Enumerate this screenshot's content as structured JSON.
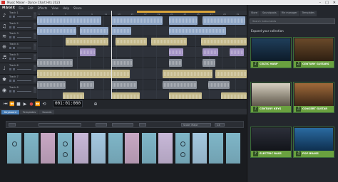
{
  "window": {
    "title": "Music Maker - Dance Chart Hits 2023",
    "minimize": "–",
    "maximize": "□",
    "close": "✕"
  },
  "menu": {
    "brand": "MAGIX",
    "items": [
      "File",
      "Edit",
      "Effects",
      "View",
      "Help",
      "Share"
    ]
  },
  "ruler": {
    "bars": [
      "1",
      "3",
      "5",
      "7",
      "9",
      "11",
      "13",
      "15",
      "17",
      "19",
      "21",
      "23",
      "25",
      "27",
      "29",
      "31"
    ]
  },
  "tracks": [
    {
      "icon": "piano-keys-icon",
      "glyph": "♪",
      "name": "Track 1"
    },
    {
      "icon": "flute-icon",
      "glyph": "♫",
      "name": "Track 2"
    },
    {
      "icon": "synth-icon",
      "glyph": "≋",
      "name": "Track 3"
    },
    {
      "icon": "drums-icon",
      "glyph": "⊕",
      "name": "Track 4"
    },
    {
      "icon": "strings-icon",
      "glyph": "♬",
      "name": "Track 5"
    },
    {
      "icon": "guitar-icon",
      "glyph": "♩",
      "name": "Track 6"
    },
    {
      "icon": "fx-icon",
      "glyph": "✱",
      "name": "Track 7"
    },
    {
      "icon": "vocal-icon",
      "glyph": "◉",
      "name": "Track 8"
    }
  ],
  "transport": {
    "timecode": "001:01:000",
    "buttons": [
      "⏮",
      "⏪",
      "■",
      "▶",
      "●",
      "⏩",
      "⟲",
      "⊕"
    ]
  },
  "bottom_tabs": [
    "Keyboard",
    "Templates",
    "Sounds"
  ],
  "keyboard": {
    "scale": "Scale: Major",
    "octave": "C3"
  },
  "right_panel": {
    "tabs": [
      "Store",
      "Soundpools",
      "File manager",
      "Templates"
    ],
    "search_placeholder": "Search instruments",
    "heading": "Expand your collection",
    "tiles": [
      {
        "label": "CELTIC HARP",
        "icon": "harp-icon",
        "glyph": "♪"
      },
      {
        "label": "CENTURY GUITARS",
        "icon": "guitar-icon",
        "glyph": "♫"
      },
      {
        "label": "CENTURY KEYS",
        "icon": "keys-icon",
        "glyph": "♪"
      },
      {
        "label": "CONCERT GUITAR",
        "icon": "guitar-icon",
        "glyph": "♫"
      },
      {
        "label": "ELECTRIC BASS",
        "icon": "bass-icon",
        "glyph": "♪"
      },
      {
        "label": "POP BRASS",
        "icon": "brass-icon",
        "glyph": "♫"
      }
    ]
  },
  "colors": {
    "accent_blue": "#4a7fb8",
    "clip_blue": "#8fa6c6",
    "clip_tan": "#c4b98a",
    "clip_purple": "#a393c4",
    "clip_gray": "#8a9099",
    "store_green": "#6aa13f",
    "loop_orange": "#d9a43a"
  }
}
